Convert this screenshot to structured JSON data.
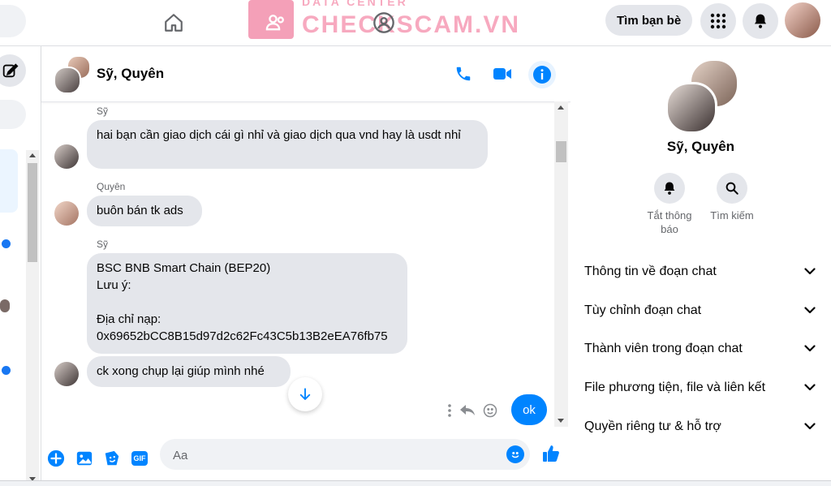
{
  "topbar": {
    "watermark_small": "DATA CENTER",
    "watermark": "CHECKSCAM.VN",
    "find_friends": "Tìm bạn bè"
  },
  "chat": {
    "title": "Sỹ, Quyên",
    "messages": [
      {
        "sender": "Sỹ",
        "text": "hai bạn cần giao dịch cái gì nhỉ và giao dịch qua vnd hay là usdt nhỉ"
      },
      {
        "sender": "Quyên",
        "text": "buôn bán tk ads"
      },
      {
        "sender": "Sỹ",
        "lines": [
          "BSC BNB Smart Chain (BEP20)",
          "Lưu ý:",
          "",
          "Địa chỉ nạp:",
          "0x69652bCC8B15d97d2c62Fc43C5b13B2eEA76fb75"
        ]
      },
      {
        "sender": "",
        "text": "ck xong chụp lại giúp mình nhé"
      }
    ],
    "own_message": "ok",
    "composer": {
      "placeholder": "Aa",
      "gif_label": "GIF"
    }
  },
  "right_panel": {
    "name": "Sỹ, Quyên",
    "actions": [
      {
        "label": "Tắt thông báo"
      },
      {
        "label": "Tìm kiếm"
      }
    ],
    "sections": [
      "Thông tin về đoạn chat",
      "Tùy chỉnh đoạn chat",
      "Thành viên trong đoạn chat",
      "File phương tiện, file và liên kết",
      "Quyền riêng tư & hỗ trợ"
    ]
  },
  "colors": {
    "accent": "#0084ff",
    "bubble": "#e4e6eb",
    "watermark": "#f7a9bf"
  }
}
